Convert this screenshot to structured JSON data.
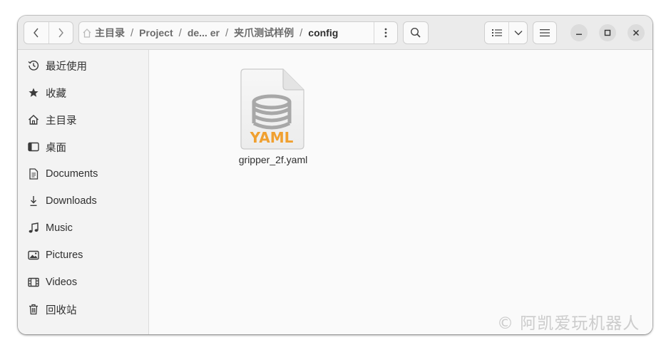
{
  "pathbar": {
    "crumbs": [
      "主目录",
      "Project",
      "de... er",
      "夹爪测试样例",
      "config"
    ],
    "separator": "/"
  },
  "sidebar": {
    "items": [
      {
        "label": "最近使用",
        "icon": "clock-icon"
      },
      {
        "label": "收藏",
        "icon": "star-icon"
      },
      {
        "label": "主目录",
        "icon": "home-icon"
      },
      {
        "label": "桌面",
        "icon": "desktop-icon"
      },
      {
        "label": "Documents",
        "icon": "document-icon"
      },
      {
        "label": "Downloads",
        "icon": "download-icon"
      },
      {
        "label": "Music",
        "icon": "music-icon"
      },
      {
        "label": "Pictures",
        "icon": "picture-icon"
      },
      {
        "label": "Videos",
        "icon": "video-icon"
      },
      {
        "label": "回收站",
        "icon": "trash-icon"
      }
    ]
  },
  "files": [
    {
      "name": "gripper_2f.yaml",
      "badge": "YAML",
      "icon": "yaml-file-icon"
    }
  ],
  "watermark": "© 阿凯爱玩机器人",
  "colors": {
    "yaml_badge": "#f0a030",
    "db_icon": "#a8a8a8",
    "headerbar": "#ebebeb",
    "sidebar": "#f3f3f3"
  }
}
